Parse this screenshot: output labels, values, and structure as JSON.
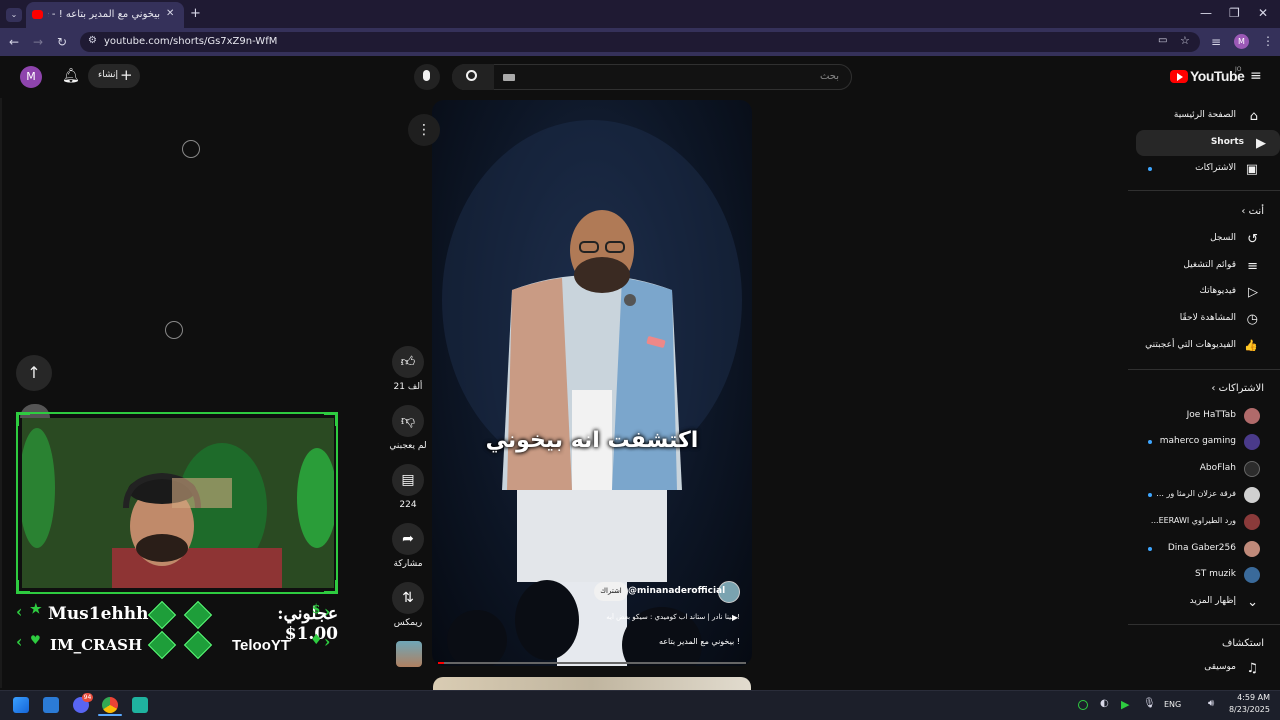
{
  "browser": {
    "tab_title": "بيخوني مع المدير بتاعه ! - be",
    "url": "youtube.com/shorts/Gs7xZ9n-WfM",
    "profile_initial": "M"
  },
  "header": {
    "logo_text": "YouTube",
    "logo_sup": "JO",
    "search_placeholder": "بحث",
    "create_label": "إنشاء",
    "avatar_initial": "M"
  },
  "sidebar": {
    "main": [
      {
        "label": "الصفحة الرئيسية",
        "icon": "⌂"
      },
      {
        "label": "Shorts",
        "icon": "▶"
      },
      {
        "label": "الاشتراكات",
        "icon": "▣"
      }
    ],
    "you_heading": "أنت",
    "you": [
      {
        "label": "السجل",
        "icon": "↺"
      },
      {
        "label": "قوائم التشغيل",
        "icon": "≡"
      },
      {
        "label": "فيديوهاتك",
        "icon": "▷"
      },
      {
        "label": "المشاهدة لاحقًا",
        "icon": "◷"
      },
      {
        "label": "الفيديوهات التي أعجبتني",
        "icon": "👍"
      }
    ],
    "subs_heading": "الاشتراكات",
    "subscriptions": [
      {
        "label": "Joe HaTTab",
        "color": "#b06a6a",
        "dot": false
      },
      {
        "label": "maherco gaming",
        "color": "#4a3a8a",
        "dot": true
      },
      {
        "label": "AboFlah",
        "color": "#2c2c2c",
        "dot": false
      },
      {
        "label": "فرقة عزلان الرمثا ور ...",
        "color": "#d0d0d0",
        "dot": true
      },
      {
        "label": "ورد الطيراوي EERAWI...",
        "color": "#8a3a3a",
        "dot": false
      },
      {
        "label": "Dina Gaber256",
        "color": "#c08a7a",
        "dot": true
      },
      {
        "label": "ST muzik",
        "color": "#3a6a9a",
        "dot": false
      }
    ],
    "show_more": "إظهار المزيد",
    "explore_heading": "استكشاف",
    "explore": [
      {
        "label": "موسيقى",
        "icon": "♫"
      }
    ]
  },
  "short": {
    "caption": "اكتشفت انه بيخوني",
    "channel": "@minanaderofficial",
    "subscribe": "اشتراك",
    "music": "مينا نادر | ستاند اب كوميدي : سيكو بعض أيه !",
    "title": "بيخوني مع المدير بتاعه !"
  },
  "actions": {
    "likes": "21 ألف",
    "dislike": "لم يعجبني",
    "comments": "224",
    "share": "مشاركة",
    "remix": "ريمكس"
  },
  "overlay": {
    "name1": "Mus1ehhh",
    "donation": "عجلوني: 1.00$",
    "name2": "IM_CRASH",
    "name3": "TelooYT"
  },
  "taskbar": {
    "lang": "ENG",
    "time": "4:59 AM",
    "date": "8/23/2025",
    "discord_badge": "94"
  }
}
